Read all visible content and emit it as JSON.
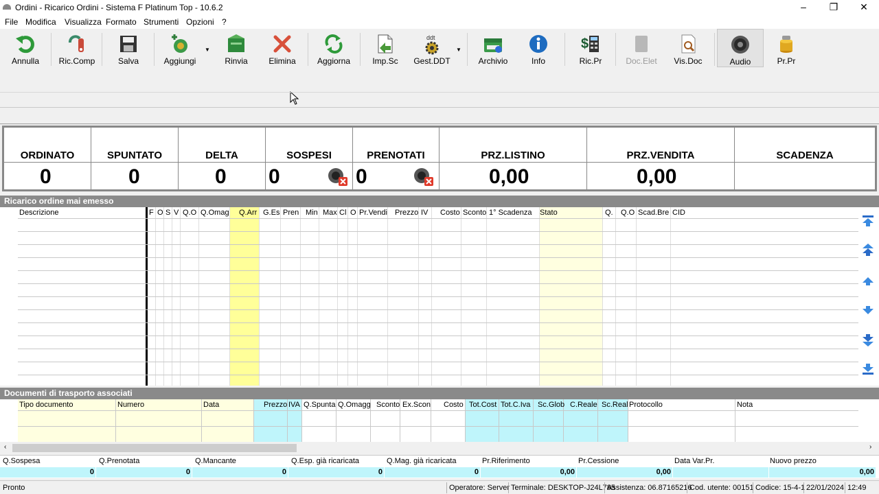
{
  "window": {
    "title": "Ordini - Ricarico Ordini - Sistema F Platinum Top - 10.6.2"
  },
  "menu": [
    "File",
    "Modifica",
    "Visualizza",
    "Formato",
    "Strumenti",
    "Opzioni",
    "?"
  ],
  "toolbar": {
    "annulla": "Annulla",
    "ric_comp": "Ric.Comp",
    "salva": "Salva",
    "aggiungi": "Aggiungi",
    "rinvia": "Rinvia",
    "elimina": "Elimina",
    "aggiorna": "Aggiorna",
    "imp_sc": "Imp.Sc",
    "gest_ddt": "Gest.DDT",
    "archivio": "Archivio",
    "info": "Info",
    "ric_pr": "Ric.Pr",
    "doc_elet": "Doc.Elet",
    "vis_doc": "Vis.Doc",
    "audio": "Audio",
    "pr_pr": "Pr.Pr"
  },
  "summary": {
    "ordinato": {
      "label": "ORDINATO",
      "value": "0"
    },
    "spuntato": {
      "label": "SPUNTATO",
      "value": "0"
    },
    "delta": {
      "label": "DELTA",
      "value": "0"
    },
    "sospesi": {
      "label": "SOSPESI",
      "value": "0"
    },
    "prenotati": {
      "label": "PRENOTATI",
      "value": "0"
    },
    "prz_listino": {
      "label": "PRZ.LISTINO",
      "value": "0,00"
    },
    "prz_vendita": {
      "label": "PRZ.VENDITA",
      "value": "0,00"
    },
    "scadenza": {
      "label": "SCADENZA",
      "value": ""
    }
  },
  "section1": {
    "title": "Ricarico ordine mai emesso",
    "columns": [
      "Descrizione",
      "F",
      "O",
      "S",
      "V",
      "Q.O",
      "Q.Omag",
      "Q.Arr",
      "G.Es",
      "Pren",
      "Min",
      "Max",
      "Cl",
      "O",
      "Pr.Vendi",
      "Prezzo",
      "IV",
      "Costo",
      "Sconto",
      "1° Scadenza",
      "Stato",
      "Q.",
      "Q.O",
      "Scad.Bre",
      "CID"
    ]
  },
  "section2": {
    "title": "Documenti di trasporto associati",
    "columns": [
      "Tipo documento",
      "Numero",
      "Data",
      "Prezzo",
      "IVA",
      "Q.Spunta",
      "Q.Omagg",
      "Sconto",
      "Ex.Scon",
      "Costo",
      "Tot.Cost",
      "Tot.C.Iva",
      "Sc.Glob",
      "C.Reale",
      "Sc.Real",
      "Protocollo",
      "Nota"
    ]
  },
  "bottom": {
    "labels": [
      "Q.Sospesa",
      "Q.Prenotata",
      "Q.Mancante",
      "Q.Esp. già ricaricata",
      "Q.Mag. già ricaricata",
      "Pr.Riferimento",
      "Pr.Cessione",
      "Data Var.Pr.",
      "Nuovo prezzo"
    ],
    "values": [
      "0",
      "0",
      "0",
      "0",
      "0",
      "0,00",
      "0,00",
      "",
      "0,00"
    ]
  },
  "status": {
    "state": "Pronto",
    "operatore": "Operatore: Server",
    "terminale": "Terminale: DESKTOP-J24L785",
    "assistenza": "Assistenza: 06.87165216",
    "cod_utente": "Cod. utente: 00151",
    "codice": "Codice: 15-4-1",
    "date": "22/01/2024",
    "time": "12:49"
  },
  "colors": {
    "yellow_col": "#ffff99",
    "light_yellow": "#ffffe0",
    "cyan": "#bff5fb",
    "section_bar": "#8a8a8a"
  }
}
